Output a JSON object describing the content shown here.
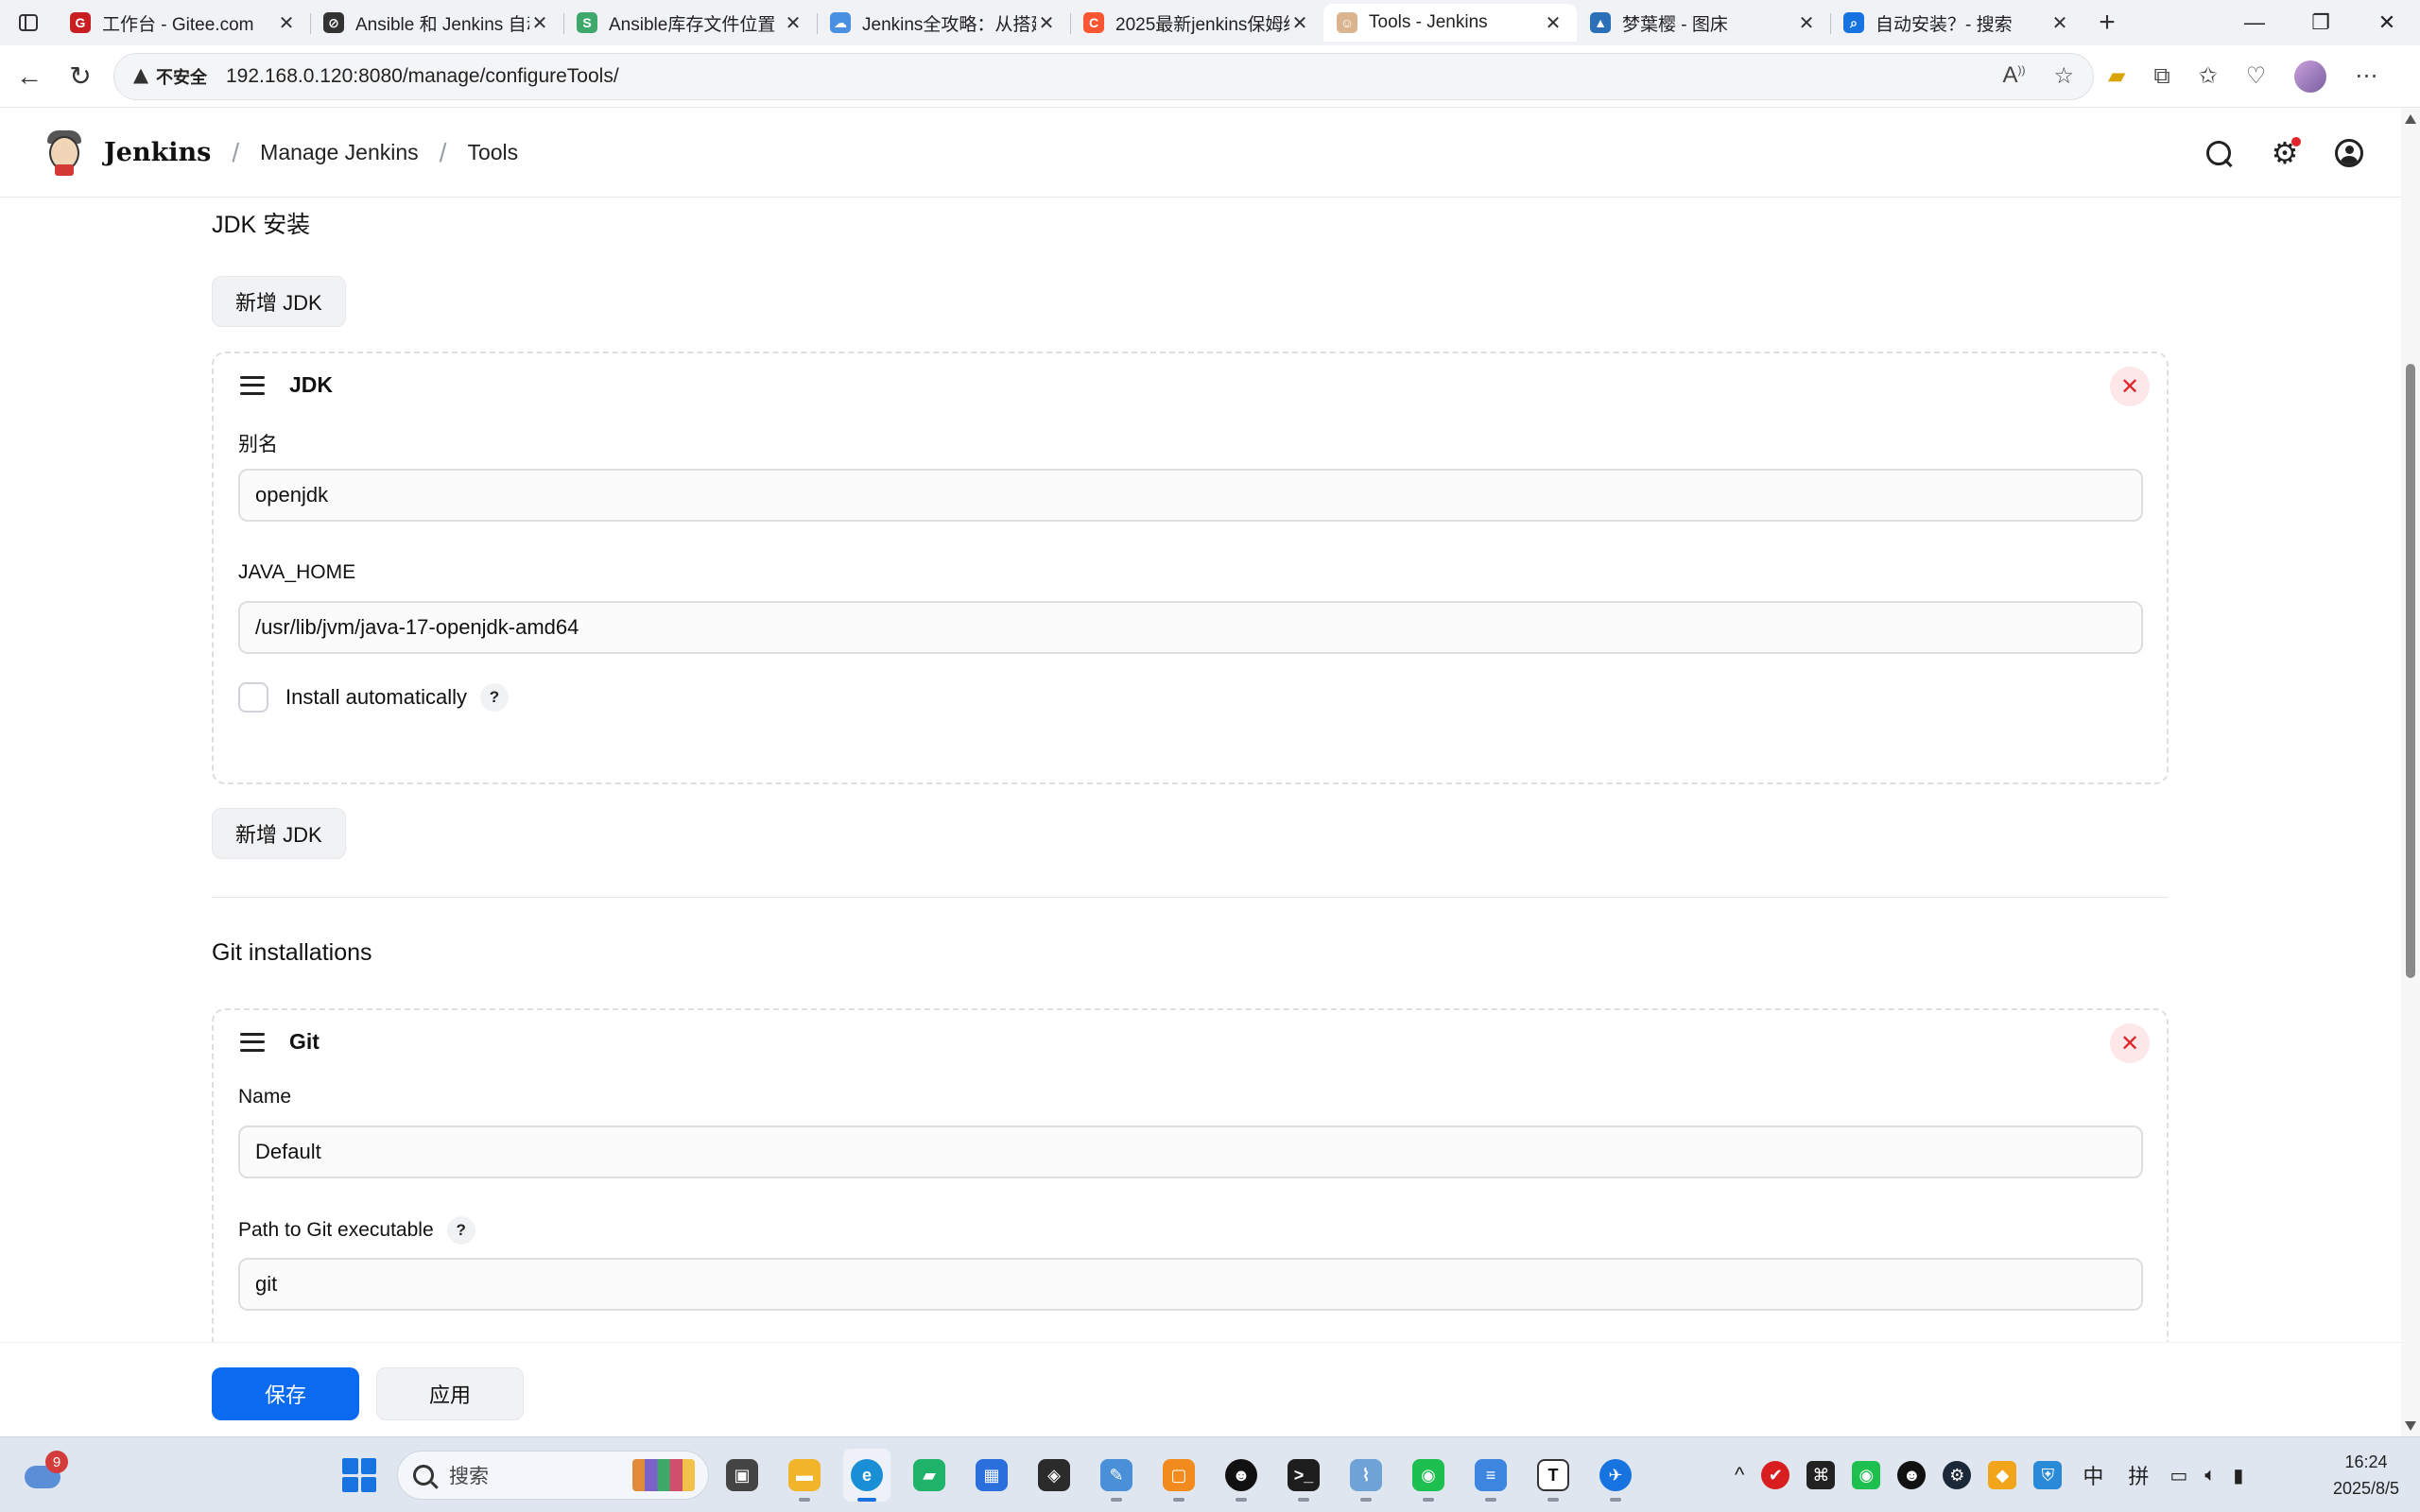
{
  "browser": {
    "tabs": [
      {
        "title": "工作台 - Gitee.com",
        "favicon_color": "#c71d23",
        "favicon_glyph": "G",
        "active": false
      },
      {
        "title": "Ansible 和 Jenkins 自动",
        "favicon_color": "#333333",
        "favicon_glyph": "⊘",
        "active": false
      },
      {
        "title": "Ansible库存文件位置",
        "favicon_color": "#3fa86b",
        "favicon_glyph": "S",
        "active": false
      },
      {
        "title": "Jenkins全攻略：从搭建",
        "favicon_color": "#4a90e2",
        "favicon_glyph": "☁",
        "active": false
      },
      {
        "title": "2025最新jenkins保姆级",
        "favicon_color": "#fc5531",
        "favicon_glyph": "C",
        "active": false
      },
      {
        "title": "Tools - Jenkins",
        "favicon_color": "#d9b48f",
        "favicon_glyph": "☺",
        "active": true
      },
      {
        "title": "梦葉樱 - 图床",
        "favicon_color": "#2a6fb8",
        "favicon_glyph": "▲",
        "active": false
      },
      {
        "title": "自动安装？- 搜索",
        "favicon_color": "#1673e0",
        "favicon_glyph": "⌕",
        "active": false
      }
    ],
    "insecure_label": "不安全",
    "url": "192.168.0.120:8080/manage/configureTools/"
  },
  "header": {
    "brand": "Jenkins",
    "breadcrumb": [
      "Manage Jenkins",
      "Tools"
    ]
  },
  "jdk": {
    "section_title": "JDK 安装",
    "add_button": "新增 JDK",
    "card": {
      "title": "JDK",
      "alias_label": "别名",
      "alias_value": "openjdk",
      "java_home_label": "JAVA_HOME",
      "java_home_value": "/usr/lib/jvm/java-17-openjdk-amd64",
      "install_auto_label": "Install automatically",
      "help": "?"
    },
    "add_button_bottom": "新增 JDK"
  },
  "git": {
    "section_title": "Git installations",
    "card": {
      "title": "Git",
      "name_label": "Name",
      "name_value": "Default",
      "path_label": "Path to Git executable",
      "path_value": "git",
      "help": "?"
    }
  },
  "actions": {
    "save": "保存",
    "apply": "应用"
  },
  "taskbar": {
    "weather_badge": "9",
    "search_placeholder": "搜索",
    "ime_lang": "中",
    "ime_mode": "拼",
    "time": "16:24",
    "date": "2025/8/5"
  }
}
